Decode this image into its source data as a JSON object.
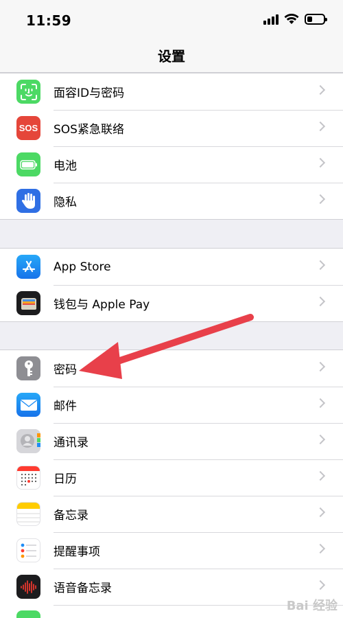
{
  "status_bar": {
    "time": "11:59"
  },
  "nav": {
    "title": "设置"
  },
  "groups": [
    {
      "items": [
        {
          "label": "面容ID与密码",
          "icon": "face-id-icon",
          "color": "#4cd964"
        },
        {
          "label": "SOS紧急联络",
          "icon": "sos-icon",
          "color": "#e5463a"
        },
        {
          "label": "电池",
          "icon": "battery-icon",
          "color": "#4cd964"
        },
        {
          "label": "隐私",
          "icon": "hand-icon",
          "color": "#2f6fe4"
        }
      ]
    },
    {
      "items": [
        {
          "label": "App Store",
          "icon": "app-store-icon",
          "color": "#1f8df5"
        },
        {
          "label": "钱包与 Apple Pay",
          "icon": "wallet-icon",
          "color": "#1c1c1e"
        }
      ]
    },
    {
      "items": [
        {
          "label": "密码",
          "icon": "key-icon",
          "color": "#8e8e93"
        },
        {
          "label": "邮件",
          "icon": "mail-icon",
          "color": "#1f8df5"
        },
        {
          "label": "通讯录",
          "icon": "contacts-icon",
          "color": "#c8c8cc"
        },
        {
          "label": "日历",
          "icon": "calendar-icon",
          "color": "#ffffff"
        },
        {
          "label": "备忘录",
          "icon": "notes-icon",
          "color": "#ffffff"
        },
        {
          "label": "提醒事项",
          "icon": "reminders-icon",
          "color": "#ffffff"
        },
        {
          "label": "语音备忘录",
          "icon": "voice-memos-icon",
          "color": "#1c1c1e"
        }
      ]
    }
  ],
  "annotation": {
    "arrow_color": "#e8404a"
  },
  "watermark": {
    "text": "Bai 经验"
  }
}
